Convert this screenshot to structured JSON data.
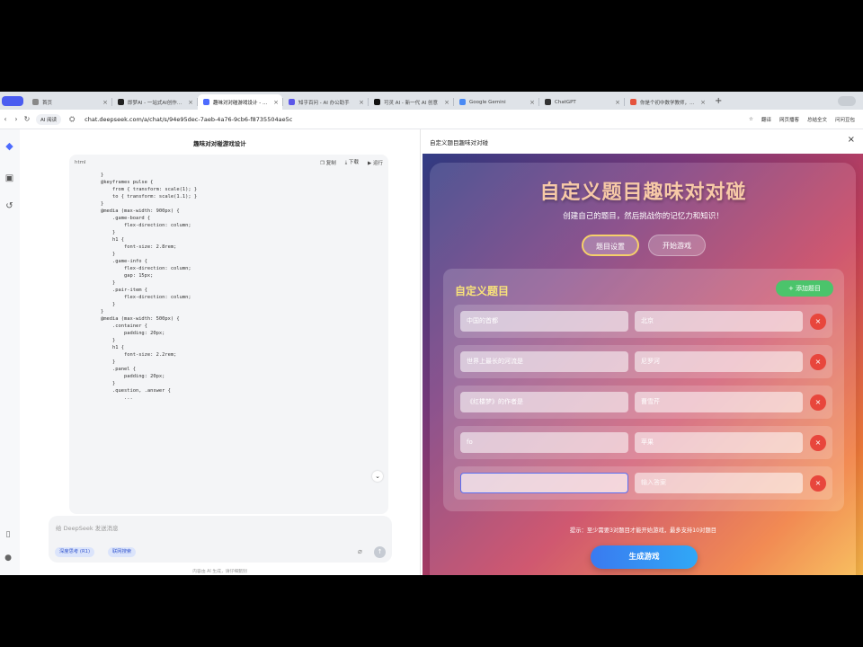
{
  "tabs": [
    {
      "title": "首页",
      "color": "#888888",
      "active": false
    },
    {
      "title": "即梦AI - 一站式AI创作平台",
      "color": "#222222",
      "active": false
    },
    {
      "title": "趣味对对碰游戏设计 - DeepSeek",
      "color": "#4d6bfe",
      "active": true
    },
    {
      "title": "知乎百问 - AI 办公助手",
      "color": "#5b57e8",
      "active": false
    },
    {
      "title": "可灵 AI - 新一代 AI 创意",
      "color": "#111111",
      "active": false
    },
    {
      "title": "Google Gemini",
      "color": "#4a8af4",
      "active": false
    },
    {
      "title": "ChatGPT",
      "color": "#333333",
      "active": false
    },
    {
      "title": "你是个初中数学教师，请帮我",
      "color": "#e5533d",
      "active": false
    }
  ],
  "address": {
    "ai_read": "AI 阅读",
    "url": "chat.deepseek.com/a/chat/s/94e95dec-7aeb-4a76-9cb6-f8735504ae5c",
    "right_items": [
      "翻译",
      "网页播客",
      "总结全文",
      "问问豆包"
    ]
  },
  "chat": {
    "title": "趣味对对碰游戏设计",
    "code_lang": "html",
    "code_actions": {
      "copy": "复制",
      "download": "下载",
      "run": "运行"
    },
    "code_lines": [
      "}",
      "",
      "@keyframes pulse {",
      "    from { transform: scale(1); }",
      "    to { transform: scale(1.1); }",
      "}",
      "",
      "@media (max-width: 900px) {",
      "    .game-board {",
      "        flex-direction: column;",
      "    }",
      "",
      "    h1 {",
      "        font-size: 2.8rem;",
      "    }",
      "",
      "    .game-info {",
      "        flex-direction: column;",
      "        gap: 15px;",
      "    }",
      "",
      "    .pair-item {",
      "        flex-direction: column;",
      "    }",
      "}",
      "",
      "@media (max-width: 500px) {",
      "    .container {",
      "        padding: 20px;",
      "    }",
      "",
      "    h1 {",
      "        font-size: 2.2rem;",
      "    }",
      "",
      "    .panel {",
      "        padding: 20px;",
      "    }",
      "",
      "    .question, .answer {",
      "        ..."
    ],
    "composer_placeholder": "给 DeepSeek 发送消息",
    "deep_think": "深度思考 (R1)",
    "web_search": "联网搜索",
    "disclaimer": "内容由 AI 生成，请仔细甄别"
  },
  "preview": {
    "header_title": "自定义题目趣味对对碰",
    "app_title": "自定义题目趣味对对碰",
    "subtitle": "创建自己的题目，然后挑战你的记忆力和知识！",
    "mode_setup": "题目设置",
    "mode_start": "开始游戏",
    "panel_title": "自定义题目",
    "add_button": "+ 添加题目",
    "rows": [
      {
        "question": "中国的首都",
        "answer": "北京"
      },
      {
        "question": "世界上最长的河流是",
        "answer": "尼罗河"
      },
      {
        "question": "《红楼梦》的作者是",
        "answer": "曹雪芹"
      },
      {
        "question": "fo",
        "answer": "苹果"
      },
      {
        "question": "",
        "answer": "",
        "answer_placeholder": "输入答案"
      }
    ],
    "hint": "提示：至少需要3对题目才能开始游戏，最多支持10对题目",
    "generate_button": "生成游戏"
  }
}
